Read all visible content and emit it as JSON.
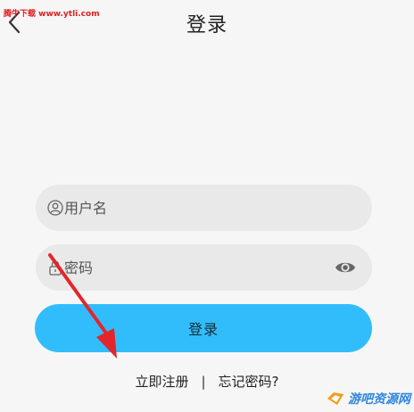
{
  "header": {
    "title": "登录",
    "watermark_top": "腾牛下载 www.ytli.com"
  },
  "form": {
    "username": {
      "placeholder": "用户名",
      "value": ""
    },
    "password": {
      "placeholder": "密码",
      "value": ""
    },
    "login_label": "登录"
  },
  "links": {
    "register": "立即注册",
    "separator": "|",
    "forgot": "忘记密码?"
  },
  "watermark_bottom": "游吧资源网",
  "icons": {
    "back": "chevron-left-icon",
    "user": "user-icon",
    "lock": "lock-icon",
    "eye": "eye-icon"
  },
  "colors": {
    "accent": "#31bdfc",
    "field_bg": "#e9e9e9",
    "page_bg": "#f6f6f6",
    "annotation_arrow": "#e3262b"
  }
}
